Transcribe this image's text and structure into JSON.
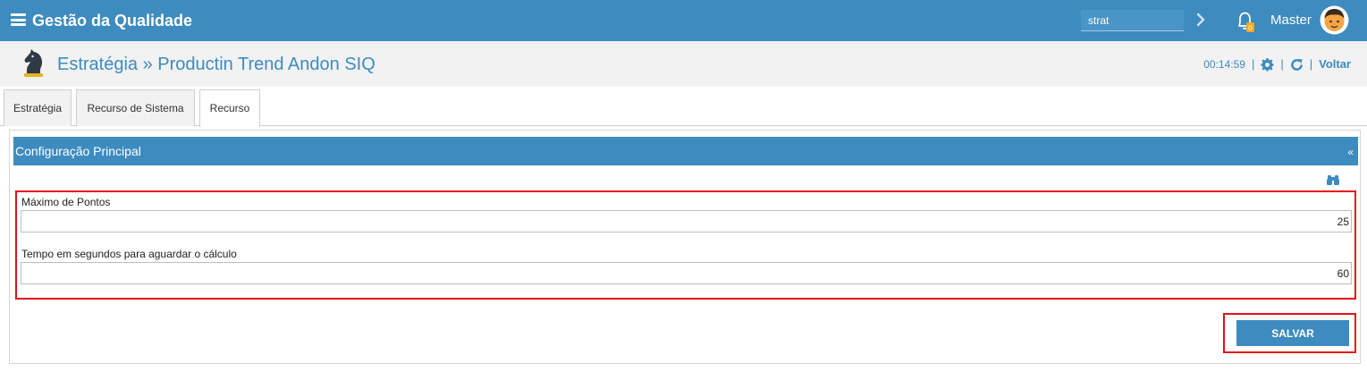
{
  "app": {
    "title": "Gestão da Qualidade",
    "search_value": "strat",
    "user_name": "Master",
    "notification_count": "0"
  },
  "header": {
    "title": "Estratégia » Productin Trend Andon SIQ",
    "timer": "00:14:59",
    "separator": "|",
    "back_label": "Voltar"
  },
  "tabs": [
    {
      "label": "Estratégia",
      "active": false
    },
    {
      "label": "Recurso de Sistema",
      "active": false
    },
    {
      "label": "Recurso",
      "active": true
    }
  ],
  "section": {
    "title": "Configuração Principal",
    "collapse_glyph": "«"
  },
  "fields": [
    {
      "label": "Máximo de Pontos",
      "value": "25"
    },
    {
      "label": "Tempo em segundos para aguardar o cálculo",
      "value": "60"
    }
  ],
  "actions": {
    "save_label": "SALVAR"
  },
  "colors": {
    "primary": "#3d8bbf",
    "highlight": "#e5101d",
    "header_bg": "#f2f2f2"
  },
  "icons": [
    "menu-icon",
    "chevron-right-icon",
    "bell-icon",
    "avatar",
    "chess-knight-icon",
    "gear-icon",
    "refresh-icon",
    "binoculars-icon"
  ]
}
